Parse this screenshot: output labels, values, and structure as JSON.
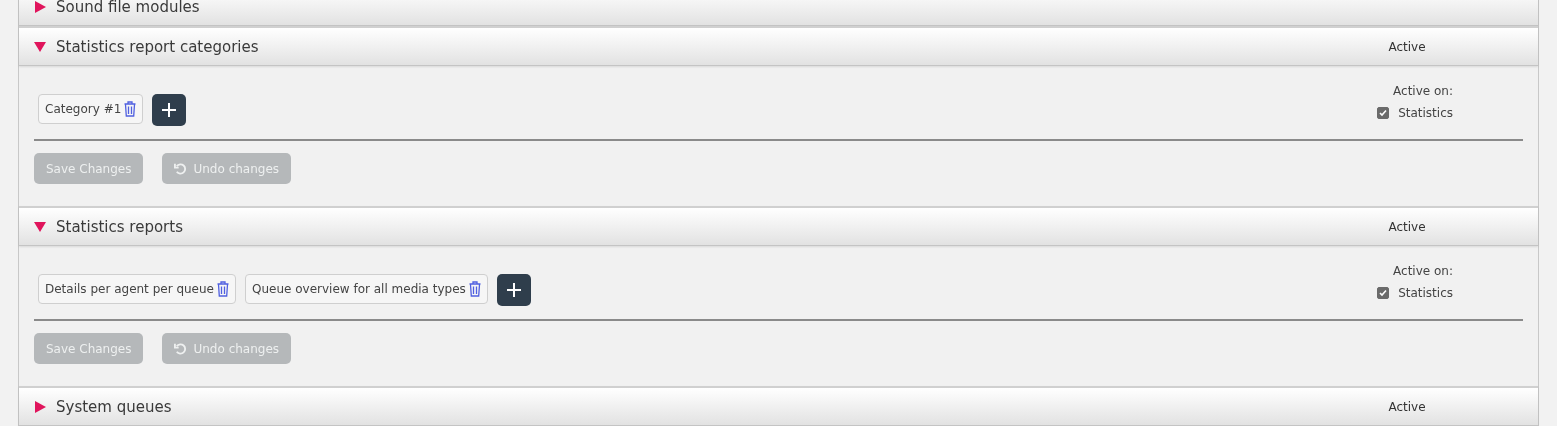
{
  "sections": [
    {
      "title": "Sound file modules",
      "expanded": false
    },
    {
      "title": "Statistics report categories",
      "expanded": true,
      "status": "Active",
      "items": [
        "Category #1"
      ],
      "active_on_label": "Active on:",
      "targets": [
        {
          "label": "Statistics",
          "checked": true
        }
      ],
      "buttons": [
        {
          "label": "Save Changes",
          "kind": "save",
          "disabled": true
        },
        {
          "label": "Undo changes",
          "kind": "undo",
          "disabled": true
        }
      ]
    },
    {
      "title": "Statistics reports",
      "expanded": true,
      "status": "Active",
      "items": [
        "Details per agent per queue",
        "Queue overview for all media types"
      ],
      "active_on_label": "Active on:",
      "targets": [
        {
          "label": "Statistics",
          "checked": true
        }
      ],
      "buttons": [
        {
          "label": "Save Changes",
          "kind": "save",
          "disabled": true
        },
        {
          "label": "Undo changes",
          "kind": "undo",
          "disabled": true
        }
      ]
    },
    {
      "title": "System queues",
      "expanded": false,
      "status": "Active"
    }
  ]
}
